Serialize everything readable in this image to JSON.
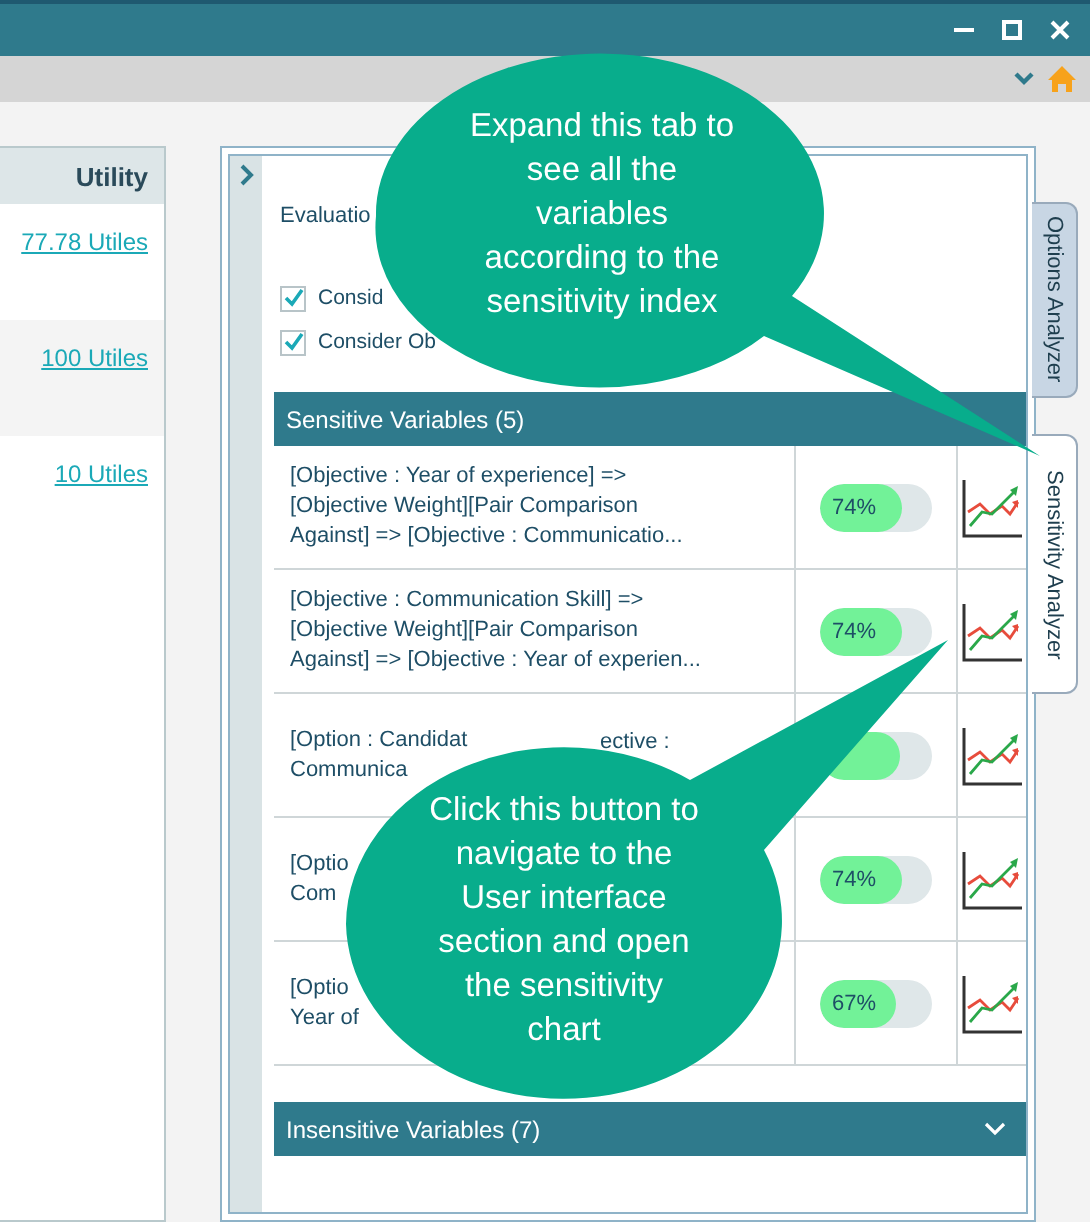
{
  "left_table": {
    "columns": [
      "Utility"
    ],
    "rows": [
      {
        "utility": "77.78 Utiles"
      },
      {
        "utility": "100 Utiles"
      },
      {
        "utility": "10 Utiles"
      }
    ]
  },
  "panel": {
    "evaluation_label": "Evaluatio",
    "checkboxes": [
      {
        "label": "Consid",
        "checked": true
      },
      {
        "label": "Consider Ob",
        "checked": true
      }
    ],
    "sensitive_section": {
      "title": "Sensitive Variables (5)",
      "rows": [
        {
          "text": "[Objective : Year of experience] =>\n[Objective Weight][Pair Comparison\nAgainst] => [Objective : Communicatio...",
          "reading": "74%",
          "level": 0.74
        },
        {
          "text": "[Objective : Communication Skill] =>\n[Objective Weight][Pair Comparison\nAgainst] => [Objective : Year of experien...",
          "reading": "74%",
          "level": 0.74
        },
        {
          "text": "[Option : Candidat\nCommunica",
          "extra": "ective :",
          "level": 0.72
        },
        {
          "text": "[Optio\nCom",
          "reading": "74%",
          "level": 0.74
        },
        {
          "text": "[Optio\nYear of",
          "reading": "67%",
          "level": 0.67
        }
      ]
    },
    "insensitive_section": {
      "title": "Insensitive Variables (7)",
      "expanded": false
    }
  },
  "side_tabs": [
    {
      "label": "Options Analyzer",
      "selected": false
    },
    {
      "label": "Sensitivity Analyzer",
      "selected": true
    }
  ],
  "callouts": [
    {
      "text": "Expand this tab to\nsee all the\nvariables\naccording to the\nsensitivity index"
    },
    {
      "text": "Click this button to\nnavigate to the\nUser interface\nsection and open\nthe sensitivity\nchart"
    }
  ]
}
